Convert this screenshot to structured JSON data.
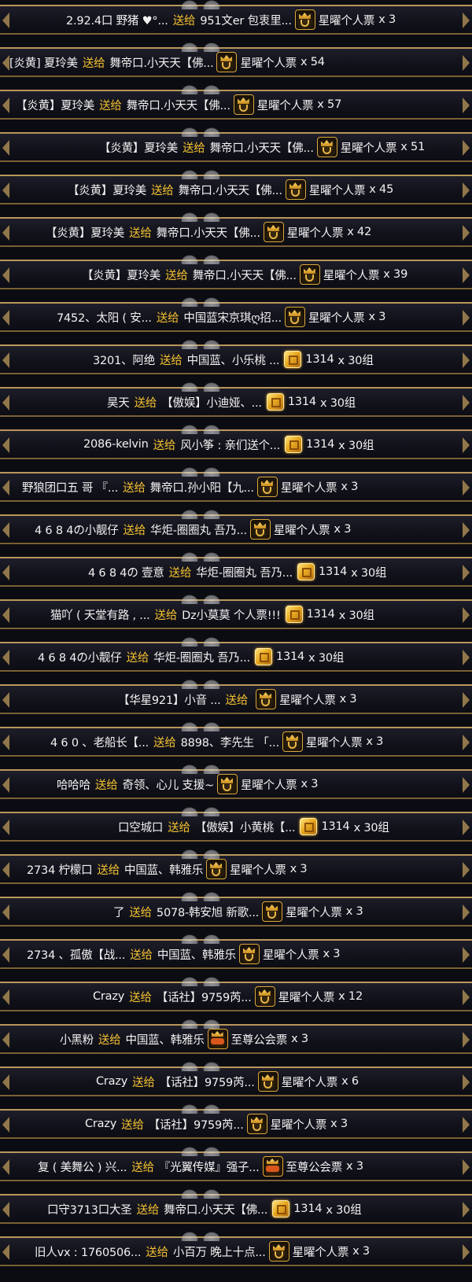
{
  "rows": [
    {
      "sender": "2.92.4口 野猪 ♥°...",
      "verb": "送给",
      "receiver": "951文er 包衷里...",
      "icon": "crown-icon",
      "gift": "星曜个人票",
      "qty": "x 3"
    },
    {
      "sender": "[炎黄] 夏玲美",
      "verb": "送给",
      "receiver": "舞帝口.小天天【佛...",
      "icon": "crown-icon",
      "gift": "星曜个人票",
      "qty": "x 54"
    },
    {
      "sender": "【炎黄】夏玲美",
      "verb": "送给",
      "receiver": "舞帝口.小天天【佛...",
      "icon": "crown-icon",
      "gift": "星曜个人票",
      "qty": "x 57"
    },
    {
      "sender": "【炎黄】夏玲美",
      "verb": "送给",
      "receiver": "舞帝口.小天天【佛...",
      "icon": "crown-icon",
      "gift": "星曜个人票",
      "qty": "x 51"
    },
    {
      "sender": "【炎黄】夏玲美",
      "verb": "送给",
      "receiver": "舞帝口.小天天【佛...",
      "icon": "crown-icon",
      "gift": "星曜个人票",
      "qty": "x 45"
    },
    {
      "sender": "【炎黄】夏玲美",
      "verb": "送给",
      "receiver": "舞帝口.小天天【佛...",
      "icon": "crown-icon",
      "gift": "星曜个人票",
      "qty": "x 42"
    },
    {
      "sender": "【炎黄】夏玲美",
      "verb": "送给",
      "receiver": "舞帝口.小天天【佛...",
      "icon": "crown-icon",
      "gift": "星曜个人票",
      "qty": "x 39"
    },
    {
      "sender": "7452、太阳 ( 安...",
      "verb": "送给",
      "receiver": "中国蓝宋京琪ღ招...",
      "icon": "crown-icon",
      "gift": "星曜个人票",
      "qty": "x 3"
    },
    {
      "sender": "3201、阿绝",
      "verb": "送给",
      "receiver": "中国蓝、小乐桃 ...",
      "icon": "gold-icon",
      "gift": "1314",
      "qty": "x 30组"
    },
    {
      "sender": "昊天",
      "verb": "送给",
      "receiver": "【傲娱】小迪娅、...",
      "icon": "gold-icon",
      "gift": "1314",
      "qty": "x 30组"
    },
    {
      "sender": "2086-kelvin",
      "verb": "送给",
      "receiver": "风小筝 : 亲们送个...",
      "icon": "gold-icon",
      "gift": "1314",
      "qty": "x 30组"
    },
    {
      "sender": "野狼团口五  哥 『...",
      "verb": "送给",
      "receiver": "舞帝口.孙小阳【九...",
      "icon": "crown-icon",
      "gift": "星曜个人票",
      "qty": "x 3"
    },
    {
      "sender": "4 6 8 4の小靓仔",
      "verb": "送给",
      "receiver": "华炬-圈圈丸 吾乃...",
      "icon": "crown-icon",
      "gift": "星曜个人票",
      "qty": "x 3"
    },
    {
      "sender": "4 6 8 4の 壹意",
      "verb": "送给",
      "receiver": "华炬-圈圈丸 吾乃...",
      "icon": "gold-icon",
      "gift": "1314",
      "qty": "x 30组"
    },
    {
      "sender": "猫吖 ( 天堂有路 , ...",
      "verb": "送给",
      "receiver": "Dz小莫莫 个人票!!!",
      "icon": "gold-icon",
      "gift": "1314",
      "qty": "x 30组"
    },
    {
      "sender": "4 6 8 4の小靓仔",
      "verb": "送给",
      "receiver": "华炬-圈圈丸 吾乃...",
      "icon": "gold-icon",
      "gift": "1314",
      "qty": "x 30组"
    },
    {
      "sender": "【华星921】小音 ...",
      "verb": "送给",
      "receiver": "",
      "icon": "crown-icon",
      "gift": "星曜个人票",
      "qty": "x 3"
    },
    {
      "sender": "4 6 0 、老船长【...",
      "verb": "送给",
      "receiver": "8898、李先生 「...",
      "icon": "crown-icon",
      "gift": "星曜个人票",
      "qty": "x 3"
    },
    {
      "sender": "哈哈哈",
      "verb": "送给",
      "receiver": "奇领、心儿 支援~",
      "icon": "crown-icon",
      "gift": "星曜个人票",
      "qty": "x 3"
    },
    {
      "sender": "口空城口",
      "verb": "送给",
      "receiver": "【傲娱】小黄桃【...",
      "icon": "gold-icon",
      "gift": "1314",
      "qty": "x 30组"
    },
    {
      "sender": "2734  柠檬口",
      "verb": "送给",
      "receiver": "中国蓝、韩雅乐",
      "icon": "crown-icon",
      "gift": "星曜个人票",
      "qty": "x 3"
    },
    {
      "sender": "了",
      "verb": "送给",
      "receiver": "5078-韩安旭 新歌...",
      "icon": "crown-icon",
      "gift": "星曜个人票",
      "qty": "x 3"
    },
    {
      "sender": "2734 、孤傲【战...",
      "verb": "送给",
      "receiver": "中国蓝、韩雅乐",
      "icon": "crown-icon",
      "gift": "星曜个人票",
      "qty": "x 3"
    },
    {
      "sender": "Crazy",
      "verb": "送给",
      "receiver": "【话社】9759芮...",
      "icon": "crown-icon",
      "gift": "星曜个人票",
      "qty": "x 12"
    },
    {
      "sender": "小黑粉",
      "verb": "送给",
      "receiver": "中国蓝、韩雅乐",
      "icon": "crown-guild-icon",
      "gift": "至尊公会票",
      "qty": "x 3"
    },
    {
      "sender": "Crazy",
      "verb": "送给",
      "receiver": "【话社】9759芮...",
      "icon": "crown-icon",
      "gift": "星曜个人票",
      "qty": "x 6"
    },
    {
      "sender": "Crazy",
      "verb": "送给",
      "receiver": "【话社】9759芮...",
      "icon": "crown-icon",
      "gift": "星曜个人票",
      "qty": "x 3"
    },
    {
      "sender": "复 ( 美舞公 ) 兴...",
      "verb": "送给",
      "receiver": "『光翼传媒』强子...",
      "icon": "crown-guild-icon",
      "gift": "至尊公会票",
      "qty": "x 3"
    },
    {
      "sender": "口守3713口大圣",
      "verb": "送给",
      "receiver": "舞帝口.小天天【佛...",
      "icon": "gold-icon",
      "gift": "1314",
      "qty": "x 30组"
    },
    {
      "sender": "旧人vx : 1760506...",
      "verb": "送给",
      "receiver": "小百万 晚上十点...",
      "icon": "crown-icon",
      "gift": "星曜个人票",
      "qty": "x 3"
    }
  ]
}
